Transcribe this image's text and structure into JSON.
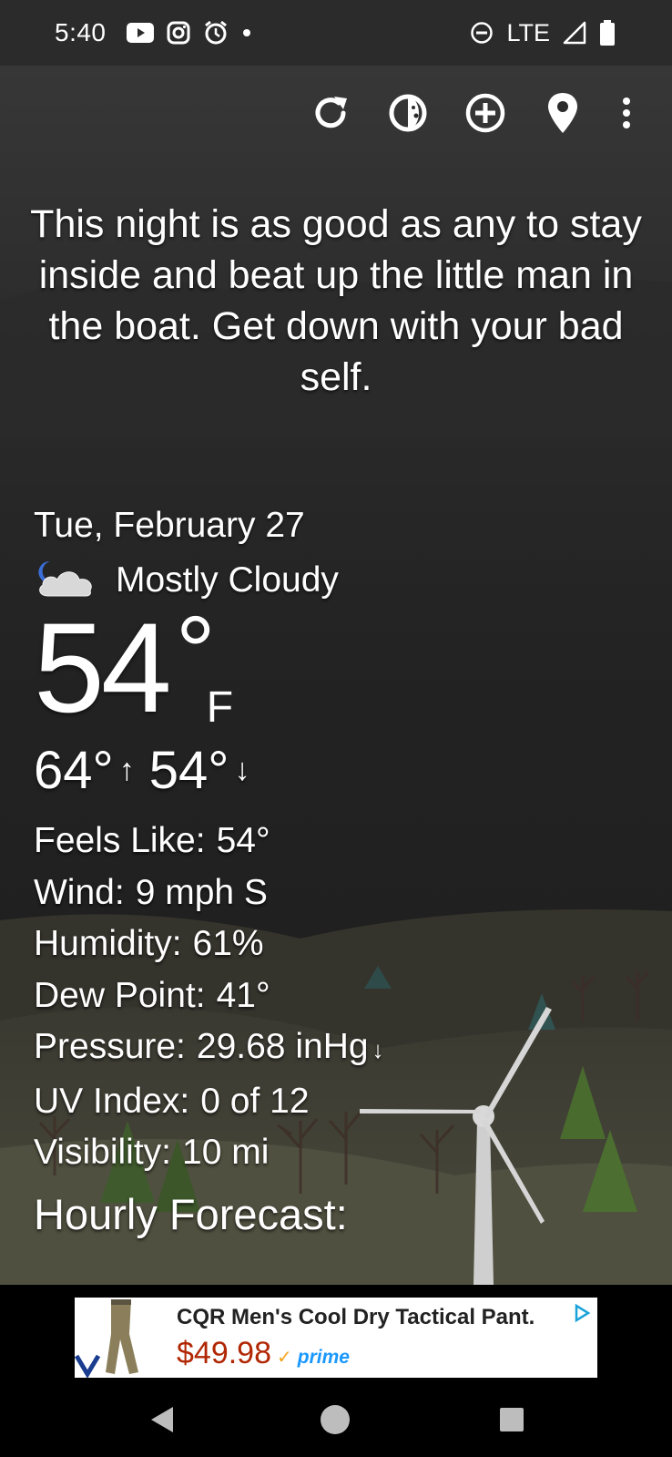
{
  "status_bar": {
    "time": "5:40",
    "network": "LTE",
    "icons": [
      "youtube-icon",
      "instagram-icon",
      "alarm-icon",
      "dot-icon",
      "do-not-disturb-icon",
      "signal-icon",
      "battery-icon"
    ]
  },
  "toolbar": {
    "icons": [
      "refresh-icon",
      "moon-phase-icon",
      "add-location-icon",
      "location-pin-icon",
      "more-vert-icon"
    ]
  },
  "quote": "This night is as good as any to stay inside and beat up the little man in the boat. Get down with your bad self.",
  "weather": {
    "date": "Tue, February 27",
    "condition": "Mostly Cloudy",
    "condition_icon": "partly-cloudy-night-icon",
    "temperature": "54",
    "degree_symbol": "°",
    "unit": "F",
    "high": "64°",
    "low": "54°",
    "high_arrow": "↑",
    "low_arrow": "↓",
    "details": {
      "feels_like_label": "Feels Like:",
      "feels_like_value": "54°",
      "wind_label": "Wind:",
      "wind_value": "9 mph S",
      "humidity_label": "Humidity:",
      "humidity_value": "61%",
      "dew_point_label": "Dew Point:",
      "dew_point_value": "41°",
      "pressure_label": "Pressure:",
      "pressure_value": "29.68 inHg",
      "pressure_trend": "↓",
      "uv_label": "UV Index:",
      "uv_value": "0 of 12",
      "visibility_label": "Visibility:",
      "visibility_value": "10 mi"
    },
    "hourly_title": "Hourly Forecast:"
  },
  "ad": {
    "title": "CQR Men's Cool Dry Tactical Pant.",
    "price": "$49.98",
    "prime": "prime",
    "check": "✓"
  },
  "colors": {
    "background": "#1f1f1f",
    "status_bar": "#2b2b2b",
    "price_red": "#b12704",
    "prime_blue": "#1a98ff",
    "prime_orange": "#f7a31c"
  }
}
